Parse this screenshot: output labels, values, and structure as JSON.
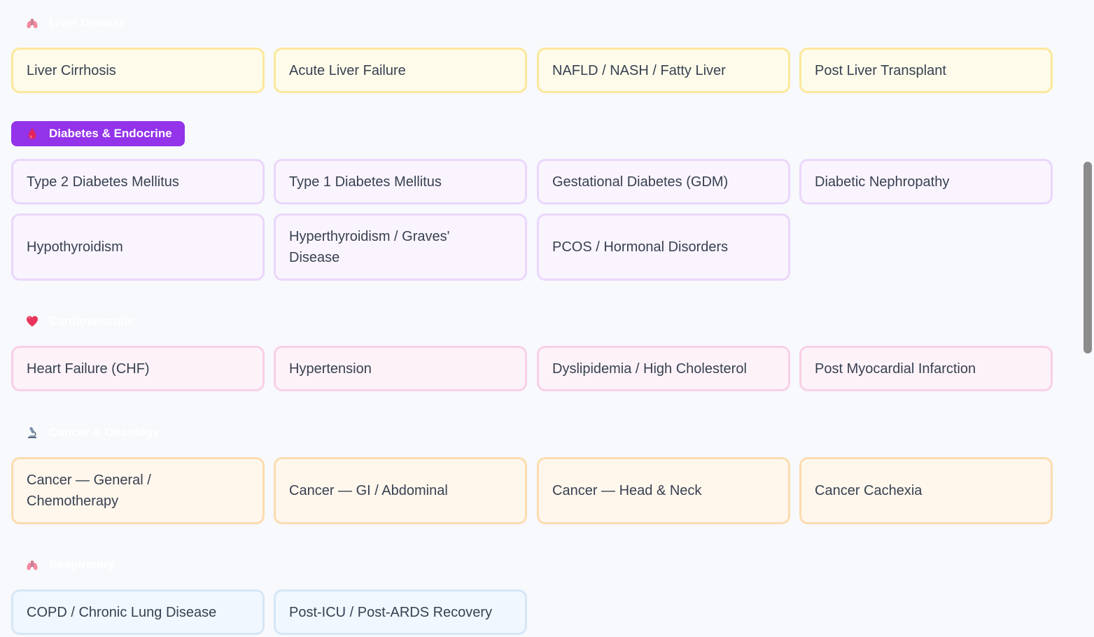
{
  "sections": [
    {
      "title": "Liver Disease",
      "icon": "lungs-icon",
      "active": false,
      "conditions": [
        "Liver Cirrhosis",
        "Acute Liver Failure",
        "NAFLD / NASH / Fatty Liver",
        "Post Liver Transplant"
      ]
    },
    {
      "title": "Diabetes & Endocrine",
      "icon": "blood-drop-icon",
      "active": true,
      "conditions": [
        "Type 2 Diabetes Mellitus",
        "Type 1 Diabetes Mellitus",
        "Gestational Diabetes (GDM)",
        "Diabetic Nephropathy",
        "Hypothyroidism",
        "Hyperthyroidism / Graves' Disease",
        "PCOS / Hormonal Disorders"
      ]
    },
    {
      "title": "Cardiovascular",
      "icon": "heart-icon",
      "active": false,
      "conditions": [
        "Heart Failure (CHF)",
        "Hypertension",
        "Dyslipidemia / High Cholesterol",
        "Post Myocardial Infarction"
      ]
    },
    {
      "title": "Cancer & Oncology",
      "icon": "microscope-icon",
      "active": false,
      "conditions": [
        "Cancer — General / Chemotherapy",
        "Cancer — GI / Abdominal",
        "Cancer — Head & Neck",
        "Cancer Cachexia"
      ]
    },
    {
      "title": "Respiratory",
      "icon": "lungs-icon",
      "active": false,
      "conditions": [
        "COPD / Chronic Lung Disease",
        "Post-ICU / Post-ARDS Recovery"
      ]
    }
  ],
  "colors": {
    "active_header": "#9333ea",
    "liver_card_bg": "#fefbea",
    "endocrine_card_bg": "#faf4fe",
    "cardio_card_bg": "#fdf2f8",
    "oncology_card_bg": "#fff6ec",
    "respiratory_card_bg": "#f0f7fe"
  }
}
